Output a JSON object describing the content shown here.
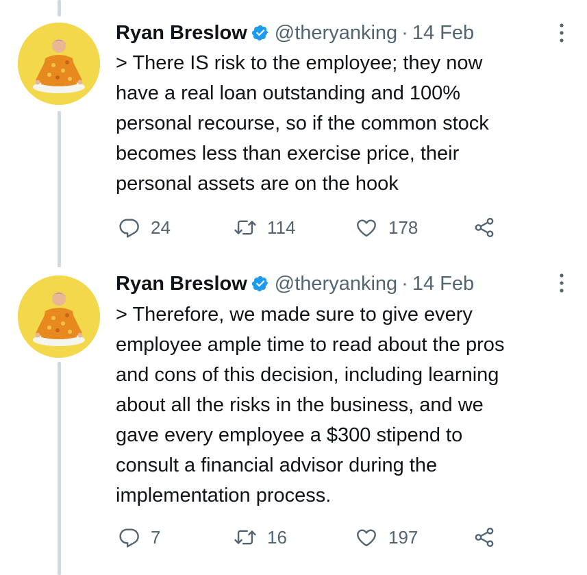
{
  "tweets": [
    {
      "author_name": "Ryan Breslow",
      "handle": "@theryanking",
      "separator": "·",
      "date": "14 Feb",
      "text": "> There IS risk to the employee; they now\nhave a real loan outstanding and 100%\npersonal recourse, so if the common stock\nbecomes less than exercise price, their\npersonal assets are on the hook",
      "replies": "24",
      "retweets": "114",
      "likes": "178"
    },
    {
      "author_name": "Ryan Breslow",
      "handle": "@theryanking",
      "separator": "·",
      "date": "14 Feb",
      "text": "> Therefore, we made sure to give every\nemployee ample time to read about the pros\nand cons of this decision, including learning\nabout all the risks in the business, and we\ngave every employee a $300 stipend to\nconsult a financial advisor during the\nimplementation process.",
      "replies": "7",
      "retweets": "16",
      "likes": "197"
    }
  ],
  "icons": {
    "verified": "verified-badge-icon",
    "more": "more-vertical-icon",
    "reply": "reply-icon",
    "retweet": "retweet-icon",
    "like": "heart-icon",
    "share": "share-icon"
  },
  "colors": {
    "text": "#0f1419",
    "secondary": "#536471",
    "verified": "#1d9bf0",
    "thread_line": "#cfd9de",
    "avatar_bg": "#f2d84a",
    "hoodie": "#e8891f"
  }
}
